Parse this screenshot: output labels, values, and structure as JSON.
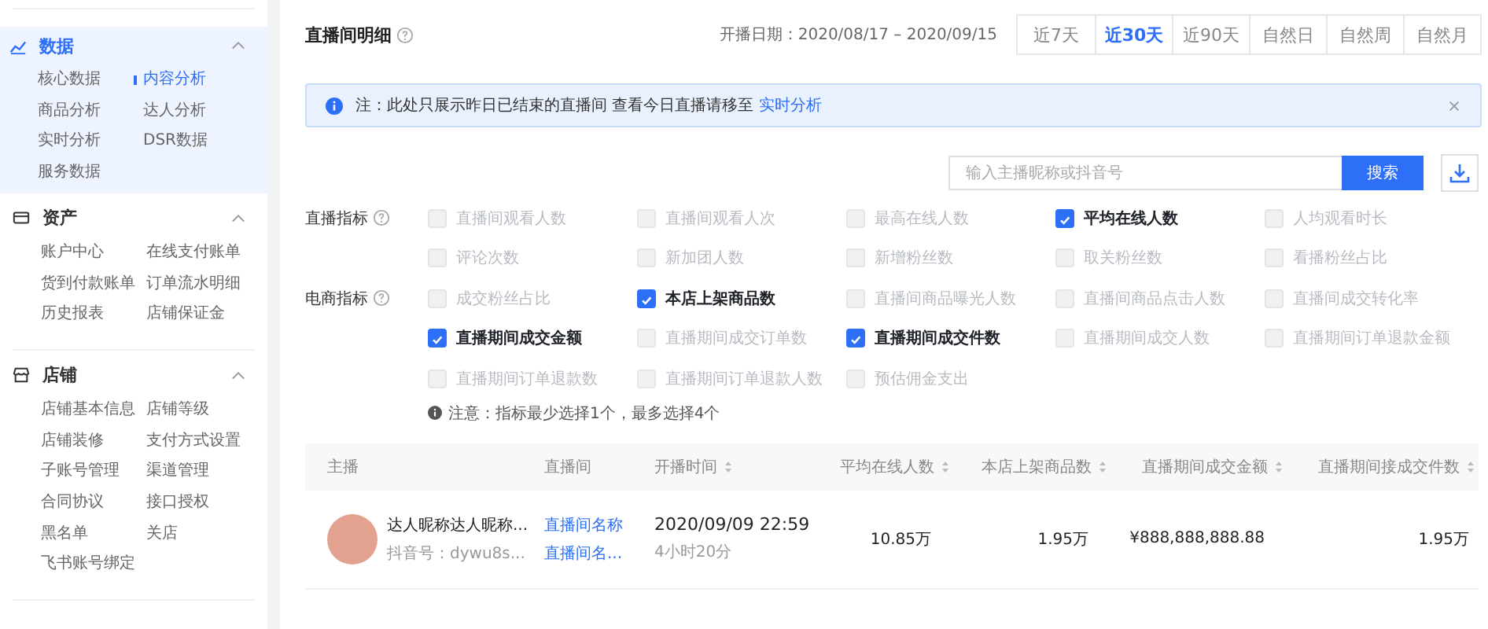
{
  "sidebar": {
    "sections": [
      {
        "title": "数据",
        "kind": "chart",
        "expanded": true,
        "active": true,
        "items": [
          {
            "label": "核心数据",
            "selected": false
          },
          {
            "label": "内容分析",
            "selected": true
          },
          {
            "label": "商品分析",
            "selected": false
          },
          {
            "label": "达人分析",
            "selected": false
          },
          {
            "label": "实时分析",
            "selected": false
          },
          {
            "label": "DSR数据",
            "selected": false
          },
          {
            "label": "服务数据",
            "selected": false
          }
        ]
      },
      {
        "title": "资产",
        "kind": "card",
        "expanded": true,
        "active": false,
        "items": [
          {
            "label": "账户中心",
            "selected": false
          },
          {
            "label": "在线支付账单",
            "selected": false
          },
          {
            "label": "货到付款账单",
            "selected": false
          },
          {
            "label": "订单流水明细",
            "selected": false
          },
          {
            "label": "历史报表",
            "selected": false
          },
          {
            "label": "店铺保证金",
            "selected": false
          }
        ]
      },
      {
        "title": "店铺",
        "kind": "shop",
        "expanded": true,
        "active": false,
        "items": [
          {
            "label": "店铺基本信息",
            "selected": false
          },
          {
            "label": "店铺等级",
            "selected": false
          },
          {
            "label": "店铺装修",
            "selected": false
          },
          {
            "label": "支付方式设置",
            "selected": false
          },
          {
            "label": "子账号管理",
            "selected": false
          },
          {
            "label": "渠道管理",
            "selected": false
          },
          {
            "label": "合同协议",
            "selected": false
          },
          {
            "label": "接口授权",
            "selected": false
          },
          {
            "label": "黑名单",
            "selected": false
          },
          {
            "label": "关店",
            "selected": false
          },
          {
            "label": "飞书账号绑定",
            "selected": false
          }
        ]
      }
    ]
  },
  "main": {
    "title": "直播间明细",
    "date_range": "开播日期：2020/08/17 – 2020/09/15",
    "range_tabs": [
      {
        "label": "近7天",
        "selected": false
      },
      {
        "label": "近30天",
        "selected": true
      },
      {
        "label": "近90天",
        "selected": false
      },
      {
        "label": "自然日",
        "selected": false
      },
      {
        "label": "自然周",
        "selected": false
      },
      {
        "label": "自然月",
        "selected": false
      }
    ],
    "notice": {
      "text": "注：此处只展示昨日已结束的直播间 查看今日直播请移至",
      "link": "实时分析"
    },
    "search": {
      "placeholder": "输入主播昵称或抖音号",
      "button": "搜索"
    },
    "metric_groups": [
      {
        "label": "直播指标",
        "rows": [
          [
            {
              "label": "直播间观看人数",
              "checked": false
            },
            {
              "label": "直播间观看人次",
              "checked": false
            },
            {
              "label": "最高在线人数",
              "checked": false
            },
            {
              "label": "平均在线人数",
              "checked": true
            },
            {
              "label": "人均观看时长",
              "checked": false
            }
          ],
          [
            {
              "label": "评论次数",
              "checked": false
            },
            {
              "label": "新加团人数",
              "checked": false
            },
            {
              "label": "新增粉丝数",
              "checked": false
            },
            {
              "label": "取关粉丝数",
              "checked": false
            },
            {
              "label": "看播粉丝占比",
              "checked": false
            }
          ]
        ]
      },
      {
        "label": "电商指标",
        "rows": [
          [
            {
              "label": "成交粉丝占比",
              "checked": false
            },
            {
              "label": "本店上架商品数",
              "checked": true
            },
            {
              "label": "直播间商品曝光人数",
              "checked": false
            },
            {
              "label": "直播间商品点击人数",
              "checked": false
            },
            {
              "label": "直播间成交转化率",
              "checked": false
            }
          ],
          [
            {
              "label": "直播期间成交金额",
              "checked": true
            },
            {
              "label": "直播期间成交订单数",
              "checked": false
            },
            {
              "label": "直播期间成交件数",
              "checked": true
            },
            {
              "label": "直播期间成交人数",
              "checked": false
            },
            {
              "label": "直播期间订单退款金额",
              "checked": false
            }
          ],
          [
            {
              "label": "直播期间订单退款数",
              "checked": false
            },
            {
              "label": "直播期间订单退款人数",
              "checked": false
            },
            {
              "label": "预估佣金支出",
              "checked": false
            }
          ]
        ]
      }
    ],
    "note": "注意：指标最少选择1个，最多选择4个",
    "table": {
      "columns": [
        {
          "label": "主播",
          "sortable": false
        },
        {
          "label": "直播间",
          "sortable": false
        },
        {
          "label": "开播时间",
          "sortable": true
        },
        {
          "label": "平均在线人数",
          "sortable": true
        },
        {
          "label": "本店上架商品数",
          "sortable": true
        },
        {
          "label": "直播期间成交金额",
          "sortable": true
        },
        {
          "label": "直播期间接成交件数",
          "sortable": true
        }
      ],
      "rows": [
        {
          "anchor": "达人昵称达人昵称...",
          "account": "抖音号：dywu8s...",
          "rooms": [
            "直播间名称",
            "直播间名..."
          ],
          "start_time": "2020/09/09 22:59",
          "duration": "4小时20分",
          "values": [
            "10.85万",
            "1.95万",
            "¥888,888,888.88",
            "1.95万"
          ]
        }
      ]
    }
  }
}
